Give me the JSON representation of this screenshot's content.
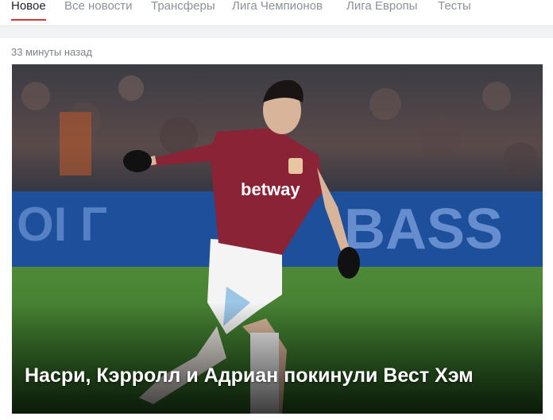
{
  "nav": {
    "tabs": [
      {
        "label": "Новое",
        "active": true
      },
      {
        "label": "Все новости",
        "active": false
      },
      {
        "label": "Трансферы",
        "active": false
      },
      {
        "label": "Лига Чемпионов",
        "active": false
      },
      {
        "label": "Лига Европы",
        "active": false
      },
      {
        "label": "Тесты",
        "active": false
      }
    ]
  },
  "article": {
    "timestamp": "33 минуты назад",
    "headline": "Насри, Кэрролл и Адриан покинули Вест Хэм",
    "photo": {
      "board_text": "BASS",
      "board_text_left": "OI Г",
      "sponsor_text": "betway"
    }
  },
  "colors": {
    "accent": "#d9362b",
    "tab_inactive": "#8c9199",
    "tab_active": "#1f2329"
  }
}
